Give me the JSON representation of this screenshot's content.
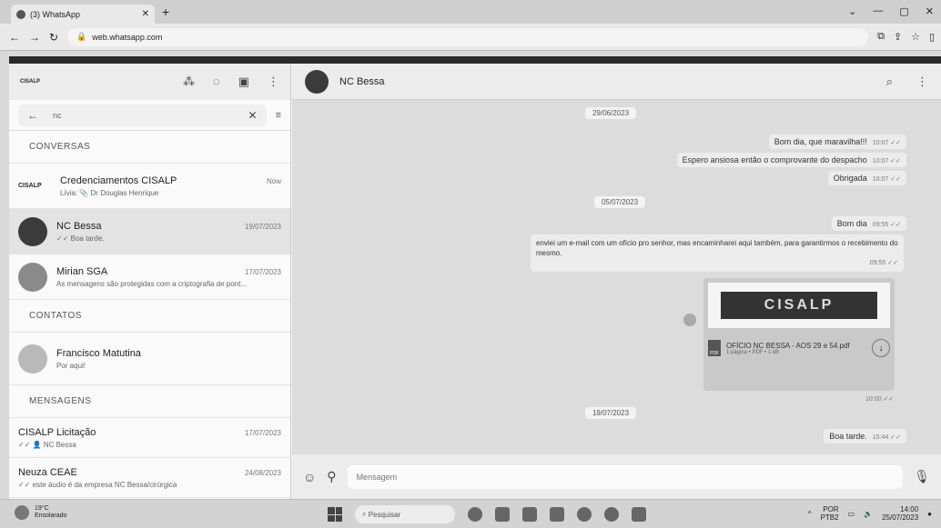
{
  "browser": {
    "tab_title": "(3) WhatsApp",
    "url": "web.whatsapp.com"
  },
  "sidebar": {
    "logo_text": "CISALP",
    "search_query": "nc",
    "section_conversas": "CONVERSAS",
    "section_contatos": "CONTATOS",
    "section_mensagens": "MENSAGENS",
    "chats": [
      {
        "name": "Credenciamentos CISALP",
        "time": "Now",
        "preview": "Lívia: 📎 Dr Douglas Henrique"
      },
      {
        "name": "NC Bessa",
        "time": "19/07/2023",
        "preview": "✓✓ Boa tarde."
      },
      {
        "name": "Mirian SGA",
        "time": "17/07/2023",
        "preview": "As mensagens são protegidas com a criptografia de pont..."
      }
    ],
    "contacts": [
      {
        "name": "Francisco Matutina",
        "status": "Por aqui!"
      }
    ],
    "messages": [
      {
        "name": "CISALP Licitação",
        "time": "17/07/2023",
        "preview": "✓✓ 👤 NC Bessa"
      },
      {
        "name": "Neuza CEAE",
        "time": "24/08/2023",
        "preview": "✓✓ este áudio é da empresa NC Bessa/cirúrgica"
      }
    ]
  },
  "conversation": {
    "contact_name": "NC Bessa",
    "date_chips": [
      "29/06/2023",
      "05/07/2023",
      "19/07/2023"
    ],
    "msg_bom_dia_1": "Bom dia, que maravilha!!!",
    "msg_bom_dia_1_time": "10:07 ✓✓",
    "msg_espero": "Espero ansiosa então o comprovante do despacho",
    "msg_espero_time": "10:07 ✓✓",
    "msg_obrigada": "Obrigada",
    "msg_obrigada_time": "10:07 ✓✓",
    "msg_bom_dia_2": "Bom dia",
    "msg_bom_dia_2_time": "09:55 ✓✓",
    "msg_long": "enviei um e-mail com um ofício pro senhor, mas encaminharei aqui também, para garantirmos o recebimento do mesmo.",
    "msg_long_time": "09:55 ✓✓",
    "doc_banner": "CISALP",
    "doc_name": "OFÍCIO NC BESSA - AOS 29 e 54.pdf",
    "doc_meta": "1 página • PDF • 1 kB",
    "doc_time": "10:00 ✓✓",
    "msg_boa_tarde": "Boa tarde.",
    "msg_boa_tarde_time": "15:44 ✓✓",
    "composer_placeholder": "Mensagem"
  },
  "taskbar": {
    "weather_temp": "19°C",
    "weather_desc": "Ensolarado",
    "search_placeholder": "Pesquisar",
    "lang_line1": "POR",
    "lang_line2": "PTB2",
    "clock_time": "14:00",
    "clock_date": "25/07/2023"
  }
}
